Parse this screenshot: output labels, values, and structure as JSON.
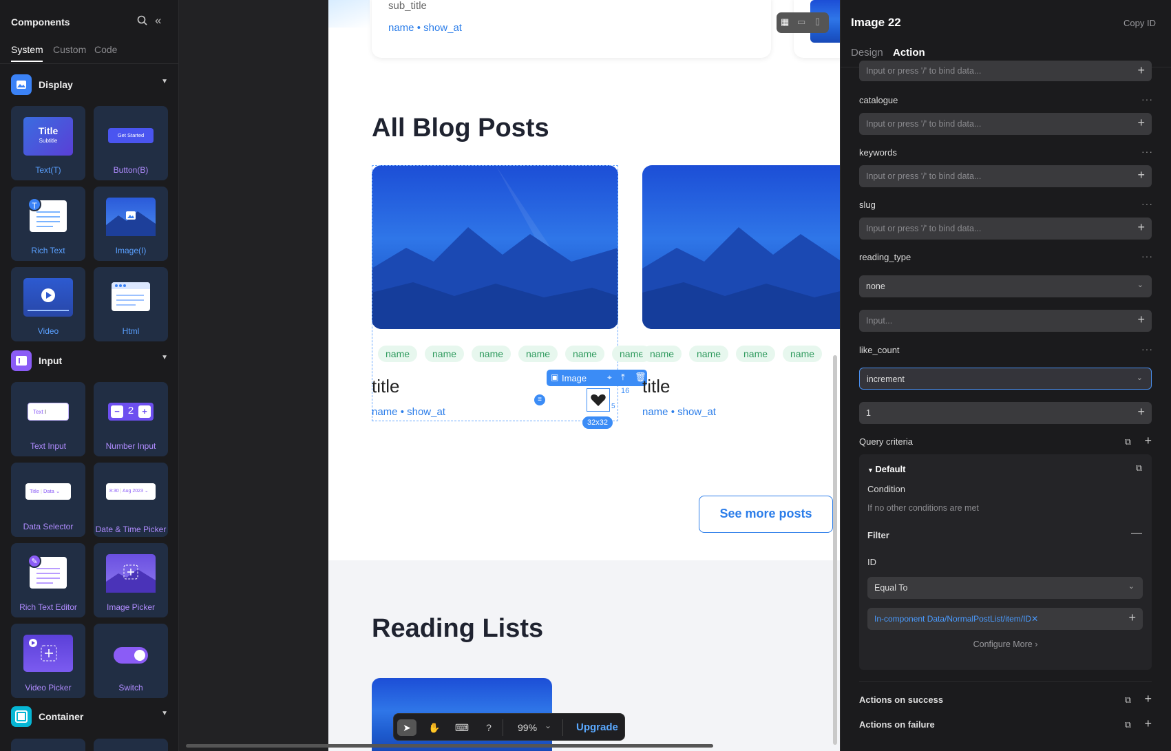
{
  "left_panel": {
    "title": "Components",
    "tabs": [
      "System",
      "Custom",
      "Code"
    ],
    "categories": {
      "display": "Display",
      "input": "Input",
      "container": "Container"
    },
    "components": {
      "text": "Text(T)",
      "text_preview_title": "Title",
      "text_preview_sub": "Subtitle",
      "button": "Button(B)",
      "button_preview": "Get Started",
      "rich_text": "Rich Text",
      "rich_text_badge": "T",
      "image": "Image(I)",
      "video": "Video",
      "html": "Html",
      "text_input": "Text Input",
      "text_input_preview": "Text",
      "number_input": "Number Input",
      "number_input_value": "2",
      "data_selector": "Data Selector",
      "data_selector_preview_a": "Title",
      "data_selector_preview_b": "Data",
      "date_time_picker": "Date & Time Picker",
      "date_preview_a": "8:30",
      "date_preview_b": "Aug 2023",
      "rich_text_editor": "Rich Text Editor",
      "image_picker": "Image Picker",
      "video_picker": "Video Picker",
      "switch": "Switch"
    }
  },
  "canvas": {
    "top_card": {
      "sub_title": "sub_title",
      "meta": "name • show_at"
    },
    "all_blog_heading": "All Blog Posts",
    "tags": [
      "name",
      "name",
      "name",
      "name",
      "name",
      "name"
    ],
    "tags2": [
      "name",
      "name",
      "name",
      "name"
    ],
    "card_title": "title",
    "card_meta": "name • show_at",
    "selection": {
      "label": "Image",
      "size": "32x32",
      "offset_label": "16",
      "offset_label_b": "5"
    },
    "see_more": "See more posts",
    "reading_heading": "Reading Lists"
  },
  "right_panel": {
    "title": "Image 22",
    "copy_id": "Copy ID",
    "tabs": [
      "Design",
      "Action"
    ],
    "placeholder": "Input or press '/' to bind data...",
    "fields": {
      "catalogue": "catalogue",
      "keywords": "keywords",
      "slug": "slug",
      "reading_type": "reading_type",
      "reading_type_value": "none",
      "input_placeholder": "Input...",
      "like_count": "like_count",
      "like_count_op": "increment",
      "like_count_value": "1"
    },
    "query": {
      "label": "Query criteria",
      "default": "Default",
      "condition_label": "Condition",
      "condition_text": "If no other conditions are met",
      "filter": "Filter",
      "id": "ID",
      "operator": "Equal To",
      "binding": "In-component Data/NormalPostList/item/ID",
      "configure_more": "Configure More"
    },
    "actions_success": "Actions on success",
    "actions_failure": "Actions on failure"
  },
  "toolbar": {
    "zoom": "99%",
    "upgrade": "Upgrade"
  },
  "colors": {
    "accent": "#2b7de9",
    "tag_bg": "#e7f7ee",
    "tag_text": "#2e9a5d",
    "upgrade": "#5aa9ff"
  }
}
